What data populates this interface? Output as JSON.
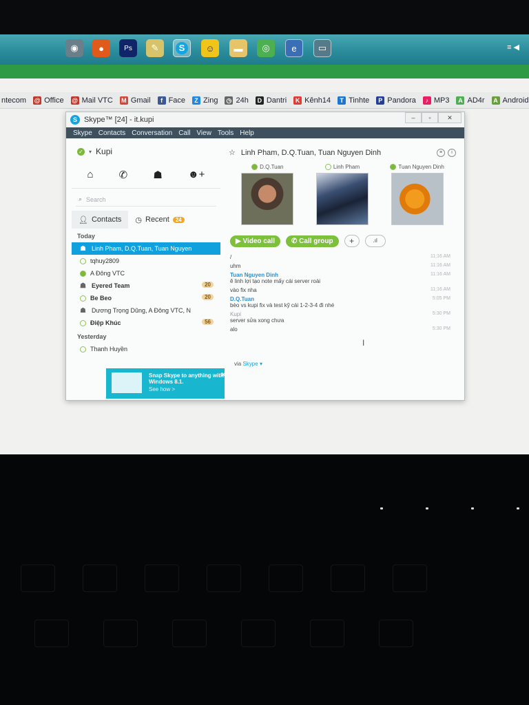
{
  "taskbar": {
    "icons": [
      "chrome-alt",
      "firefox",
      "Ps",
      "notepad",
      "S",
      "smiley",
      "folder",
      "chrome",
      "ie",
      "monitor"
    ],
    "tray": "≡ ◀"
  },
  "bookmarks": [
    {
      "label": "ntecom",
      "icon": ""
    },
    {
      "label": "Office",
      "icon": "@"
    },
    {
      "label": "Mail VTC",
      "icon": "@"
    },
    {
      "label": "Gmail",
      "icon": "M"
    },
    {
      "label": "Face",
      "icon": "f"
    },
    {
      "label": "Zing",
      "icon": "Z"
    },
    {
      "label": "24h",
      "icon": "◷"
    },
    {
      "label": "Dantri",
      "icon": "D"
    },
    {
      "label": "Kênh14",
      "icon": "K"
    },
    {
      "label": "Tinhte",
      "icon": "T"
    },
    {
      "label": "Pandora",
      "icon": "P"
    },
    {
      "label": "MP3",
      "icon": "♪"
    },
    {
      "label": "AD4r",
      "icon": "A"
    },
    {
      "label": "Android.vn",
      "icon": "A"
    }
  ],
  "skype": {
    "title": "Skype™ [24] - it.kupi",
    "menu": [
      "Skype",
      "Contacts",
      "Conversation",
      "Call",
      "View",
      "Tools",
      "Help"
    ],
    "profile_name": "Kupi",
    "search_placeholder": "Search",
    "tabs": {
      "contacts": "Contacts",
      "recent": "Recent",
      "recent_count": "24"
    },
    "groups": {
      "today": "Today",
      "yesterday": "Yesterday"
    },
    "contacts": [
      {
        "name": "Linh Pham, D.Q.Tuan, Tuan Nguyen",
        "selected": true,
        "kind": "group",
        "bold": false,
        "badge": ""
      },
      {
        "name": "tqhuy2809",
        "selected": false,
        "kind": "person",
        "bold": false,
        "badge": ""
      },
      {
        "name": "A Đông VTC",
        "selected": false,
        "kind": "online",
        "bold": false,
        "badge": ""
      },
      {
        "name": "Eyered Team",
        "selected": false,
        "kind": "group",
        "bold": true,
        "badge": "20"
      },
      {
        "name": "Be Beo",
        "selected": false,
        "kind": "person",
        "bold": true,
        "badge": "20"
      },
      {
        "name": "Dương Trọng Dũng, A Đông VTC, N",
        "selected": false,
        "kind": "group",
        "bold": false,
        "badge": ""
      },
      {
        "name": "Điệp Khúc",
        "selected": false,
        "kind": "person",
        "bold": true,
        "badge": "56"
      }
    ],
    "yesterday_contacts": [
      {
        "name": "Thanh Huyền"
      }
    ],
    "snap": {
      "text": "Snap Skype to anything with Windows 8.1.",
      "link": "See how >"
    },
    "conversation": {
      "title": "Linh Pham, D.Q.Tuan, Tuan Nguyen Dinh",
      "participants": [
        {
          "name": "D.Q.Tuan",
          "online": true
        },
        {
          "name": "Linh Pham",
          "online": false
        },
        {
          "name": "Tuan Nguyen Dinh",
          "online": true
        }
      ],
      "video_call": "Video call",
      "call_group": "Call group",
      "messages": [
        {
          "who": "",
          "text": "/",
          "time": "11:16 AM"
        },
        {
          "who": "",
          "text": "uhm",
          "time": "11:16 AM"
        },
        {
          "who": "Tuan Nguyen Dinh",
          "text": "ê linh lợi tạo note mấy cái server roài",
          "time": "11:16 AM"
        },
        {
          "who": "",
          "text": "vào fix nha",
          "time": "11:16 AM"
        },
        {
          "who": "D.Q.Tuan",
          "text": "bèo vs kupi fix và test kỹ cái 1-2-3-4 đi nhé",
          "time": "5:05 PM"
        },
        {
          "who": "Kupi",
          "text": "server sửa xong chưa",
          "time": "5:30 PM"
        },
        {
          "who": "",
          "text": "alo",
          "time": "5:30 PM"
        }
      ],
      "via_prefix": "via",
      "via_service": "Skype"
    }
  },
  "colors": {
    "skype_blue": "#0fa0dd",
    "menu_bar": "#3e4f5e",
    "call_green": "#7cc03c",
    "badge_orange": "#f5a623",
    "taskbar_teal": "#2b8c9c"
  }
}
